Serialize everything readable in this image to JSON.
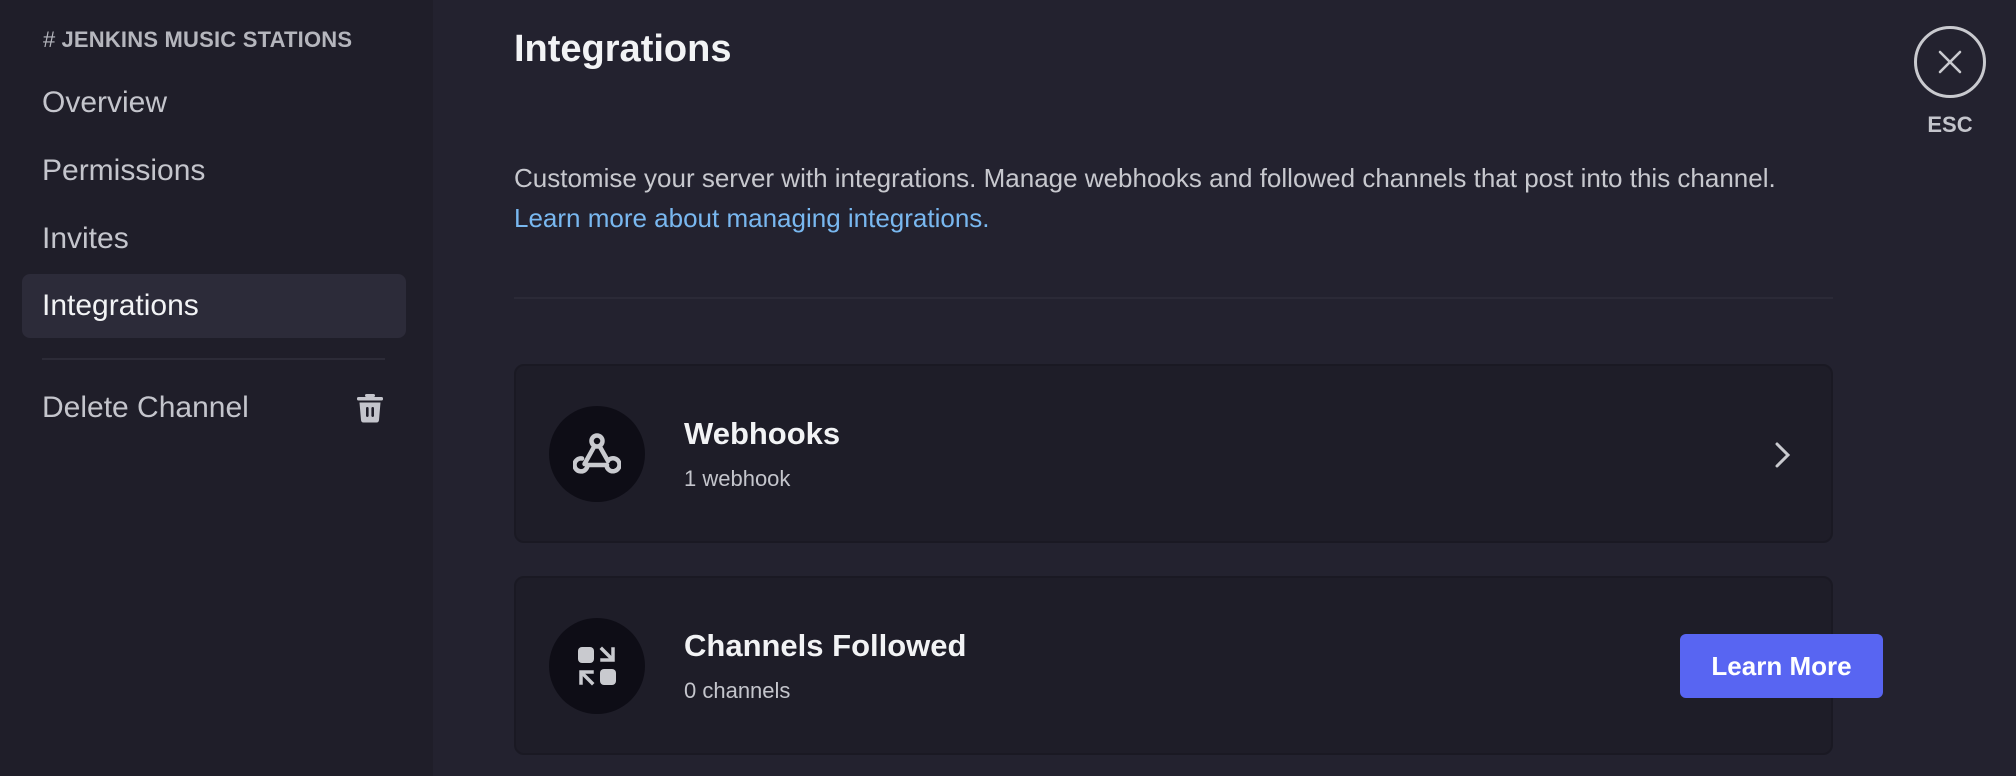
{
  "sidebar": {
    "header_hash": "#",
    "header_title": "JENKINS MUSIC STATIONS",
    "items": [
      {
        "label": "Overview",
        "selected": false
      },
      {
        "label": "Permissions",
        "selected": false
      },
      {
        "label": "Invites",
        "selected": false
      },
      {
        "label": "Integrations",
        "selected": true
      }
    ],
    "danger_item": {
      "label": "Delete Channel",
      "icon": "trash-icon"
    }
  },
  "main": {
    "title": "Integrations",
    "description": "Customise your server with integrations. Manage webhooks and followed channels that post into this channel.",
    "help_link": "Learn more about managing integrations.",
    "cards": [
      {
        "title": "Webhooks",
        "subtitle": "1 webhook",
        "icon": "webhook-icon",
        "action_icon": "chevron-right-icon"
      },
      {
        "title": "Channels Followed",
        "subtitle": "0 channels",
        "icon": "channels-followed-icon",
        "action_label": "Learn More"
      }
    ]
  },
  "close": {
    "icon": "close-icon",
    "label": "ESC"
  },
  "colors": {
    "accent": "#5865f2",
    "link": "#79b8f0",
    "sidebar_bg": "#1f1e29",
    "main_bg": "#23222f"
  }
}
